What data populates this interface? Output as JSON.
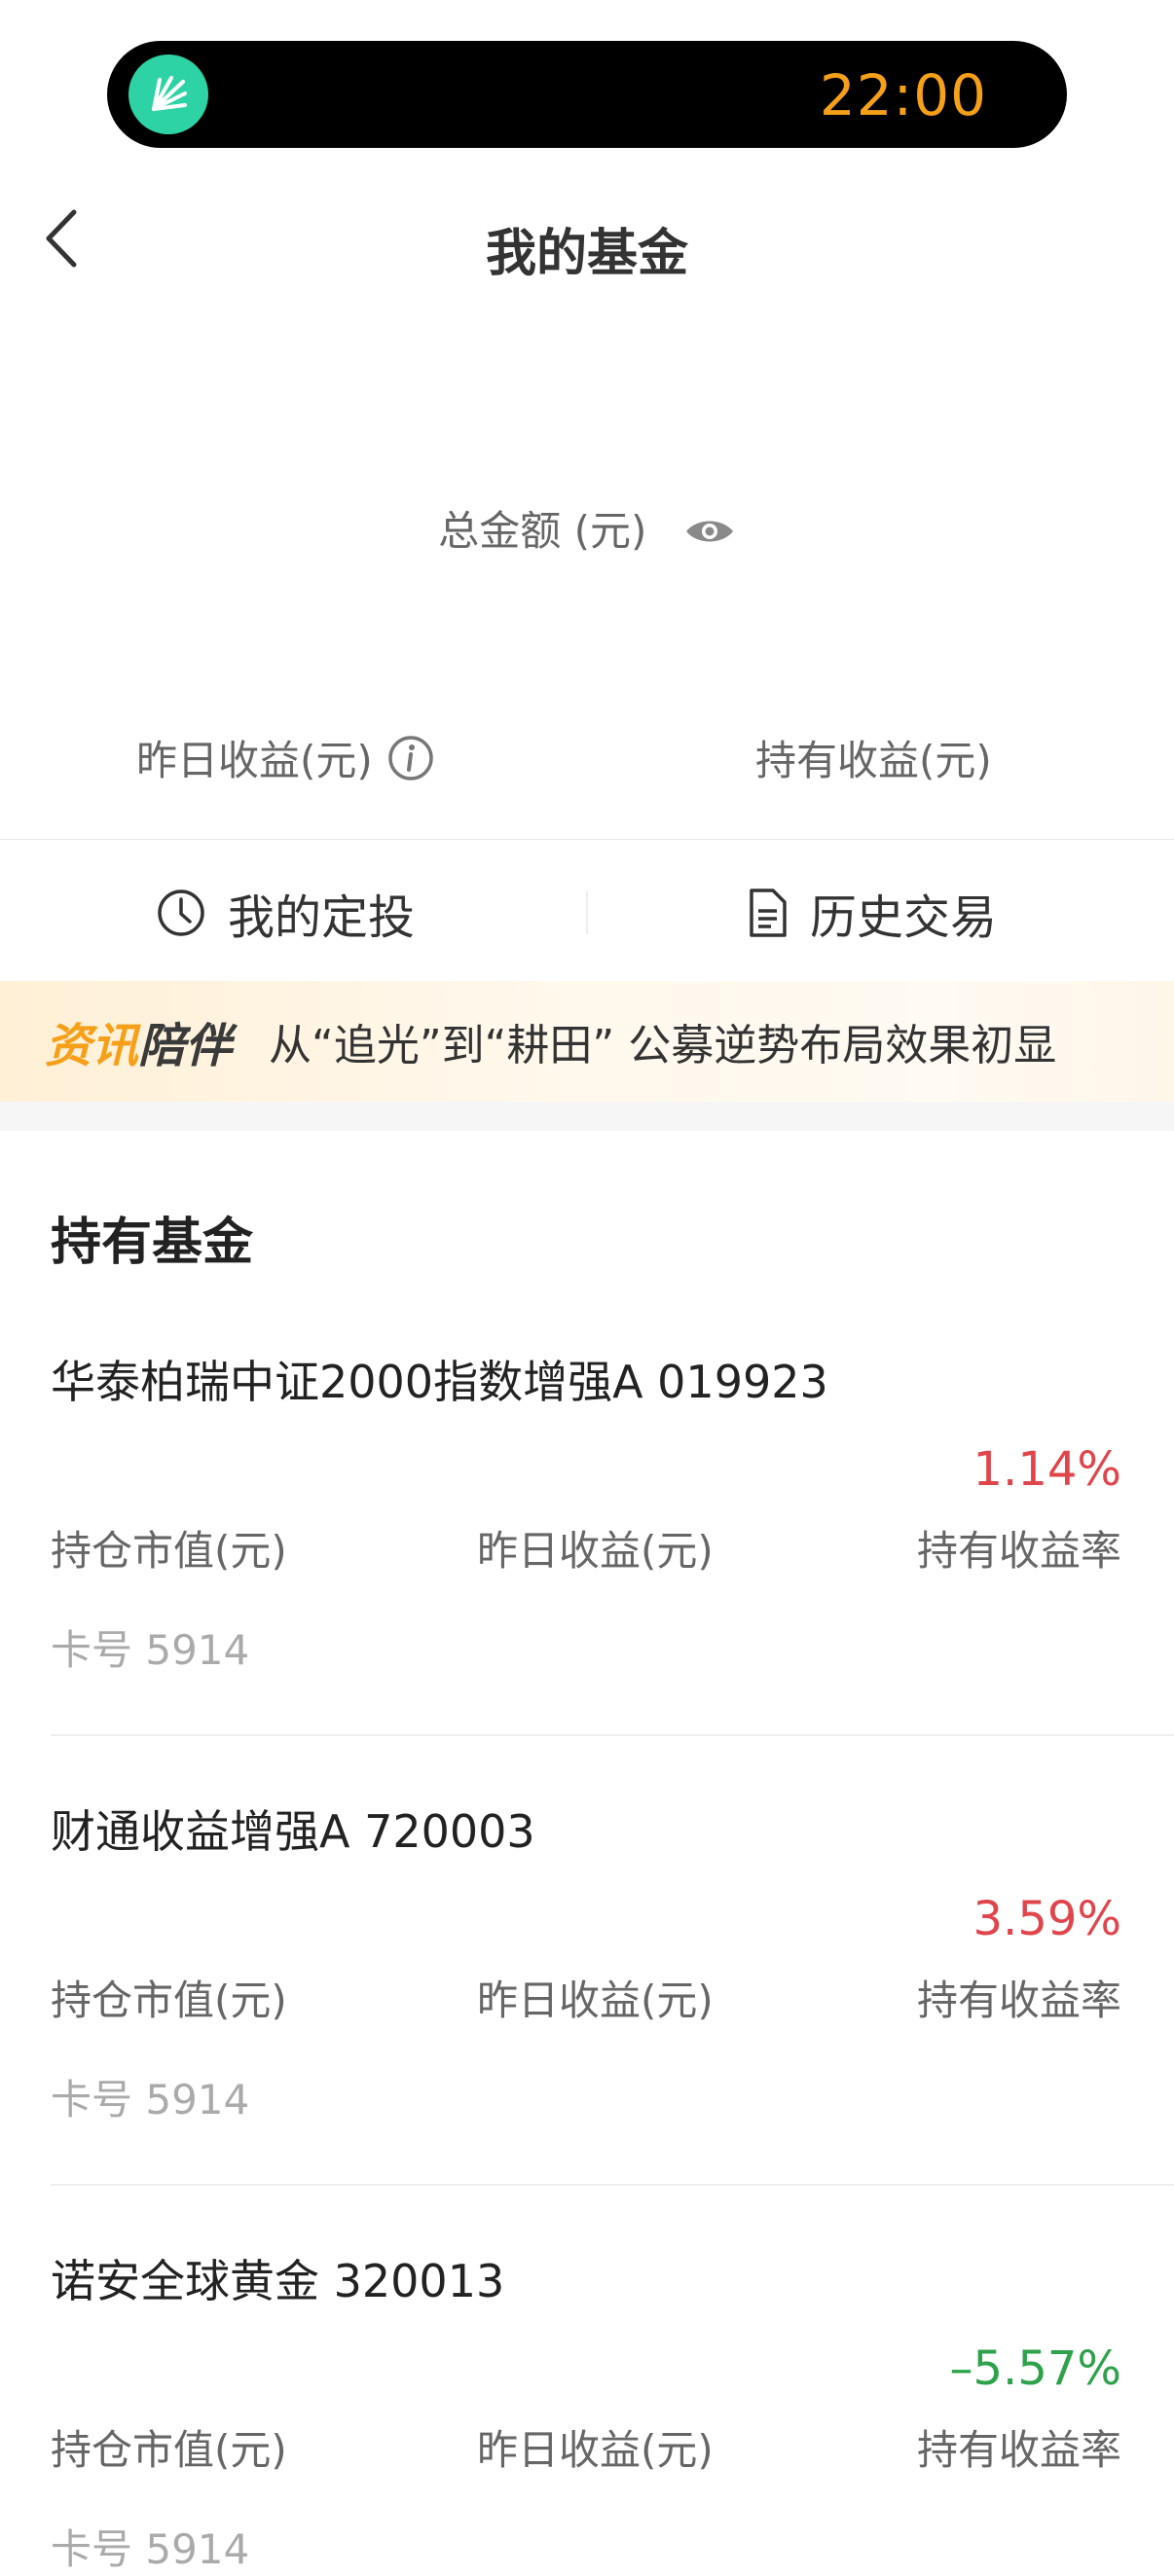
{
  "status": {
    "time": "22:00"
  },
  "header": {
    "title": "我的基金"
  },
  "summary": {
    "total_label": "总金额 (元)",
    "yesterday_label": "昨日收益(元)",
    "holding_label": "持有收益(元)"
  },
  "actions": {
    "dingtou_label": "我的定投",
    "history_label": "历史交易"
  },
  "banner": {
    "tag_a": "资讯",
    "tag_b": "陪伴",
    "text": "从“追光”到“耕田” 公募逆势布局效果初显"
  },
  "holdings": {
    "title": "持有基金",
    "funds": [
      {
        "name": "华泰柏瑞中证2000指数增强A 019923",
        "rate": "1.14%",
        "rate_color": "#e0454b",
        "col1": "持仓市值(元)",
        "col2": "昨日收益(元)",
        "col3": "持有收益率",
        "card": "卡号 5914"
      },
      {
        "name": "财通收益增强A 720003",
        "rate": "3.59%",
        "rate_color": "#e0454b",
        "col1": "持仓市值(元)",
        "col2": "昨日收益(元)",
        "col3": "持有收益率",
        "card": "卡号 5914"
      },
      {
        "name": "诺安全球黄金 320013",
        "rate": "–5.57%",
        "rate_color": "#2ea24b",
        "col1": "持仓市值(元)",
        "col2": "昨日收益(元)",
        "col3": "持有收益率",
        "card": "卡号 5914"
      }
    ]
  },
  "icons": {
    "back": "chevron-left-icon",
    "eye": "eye-icon",
    "info": "info-icon",
    "clock": "clock-icon",
    "document": "document-icon"
  }
}
